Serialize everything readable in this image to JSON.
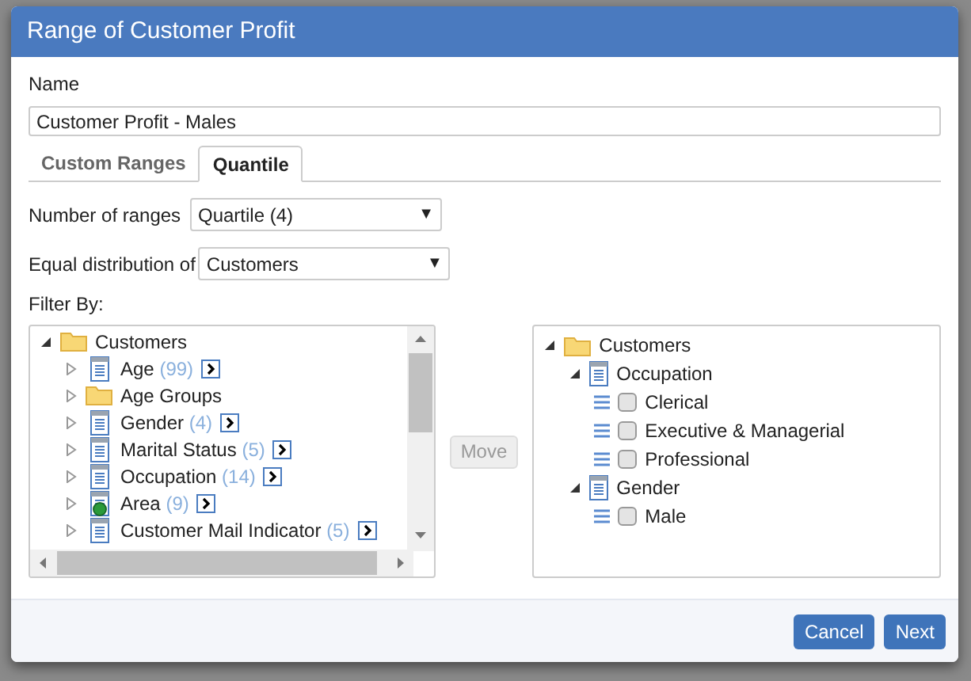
{
  "window": {
    "title": "Range of Customer Profit"
  },
  "name_field": {
    "label": "Name",
    "value": "Customer Profit - Males"
  },
  "tabs": [
    {
      "label": "Custom Ranges",
      "selected": false
    },
    {
      "label": "Quantile",
      "selected": true
    }
  ],
  "settings": [
    {
      "label": "Number of ranges",
      "value": "Quartile (4)",
      "arrow": "▼"
    },
    {
      "label": "Equal distribution of",
      "value": "Customers",
      "arrow": "▼"
    }
  ],
  "filter_label": "Filter By:",
  "source_tree": {
    "label": "Customers",
    "kind": "folder",
    "expanded": true,
    "children": [
      {
        "label": "Age",
        "kind": "attribute",
        "count": "(99)",
        "expanded": false
      },
      {
        "label": "Age Groups",
        "kind": "folder",
        "expanded": false
      },
      {
        "label": "Gender",
        "kind": "attribute",
        "count": "(4)",
        "expanded": false
      },
      {
        "label": "Marital Status",
        "kind": "attribute",
        "count": "(5)",
        "expanded": false
      },
      {
        "label": "Occupation",
        "kind": "attribute",
        "count": "(14)",
        "expanded": false
      },
      {
        "label": "Area",
        "kind": "geo",
        "count": "(9)",
        "expanded": false
      },
      {
        "label": "Customer Mail Indicator",
        "kind": "attribute",
        "count": "(5)",
        "expanded": false
      }
    ]
  },
  "move_button": {
    "label": "Move",
    "disabled": true
  },
  "target_tree": {
    "label": "Customers",
    "kind": "folder",
    "expanded": true,
    "children": [
      {
        "label": "Occupation",
        "kind": "attribute",
        "expanded": true,
        "children": [
          {
            "label": "Clerical",
            "kind": "element",
            "checked": false
          },
          {
            "label": "Executive & Managerial",
            "kind": "element",
            "checked": false
          },
          {
            "label": "Professional",
            "kind": "element",
            "checked": false
          }
        ]
      },
      {
        "label": "Gender",
        "kind": "attribute",
        "expanded": true,
        "children": [
          {
            "label": "Male",
            "kind": "element",
            "checked": false
          }
        ]
      }
    ]
  },
  "buttons": [
    {
      "label": "Cancel"
    },
    {
      "label": "Next"
    }
  ]
}
